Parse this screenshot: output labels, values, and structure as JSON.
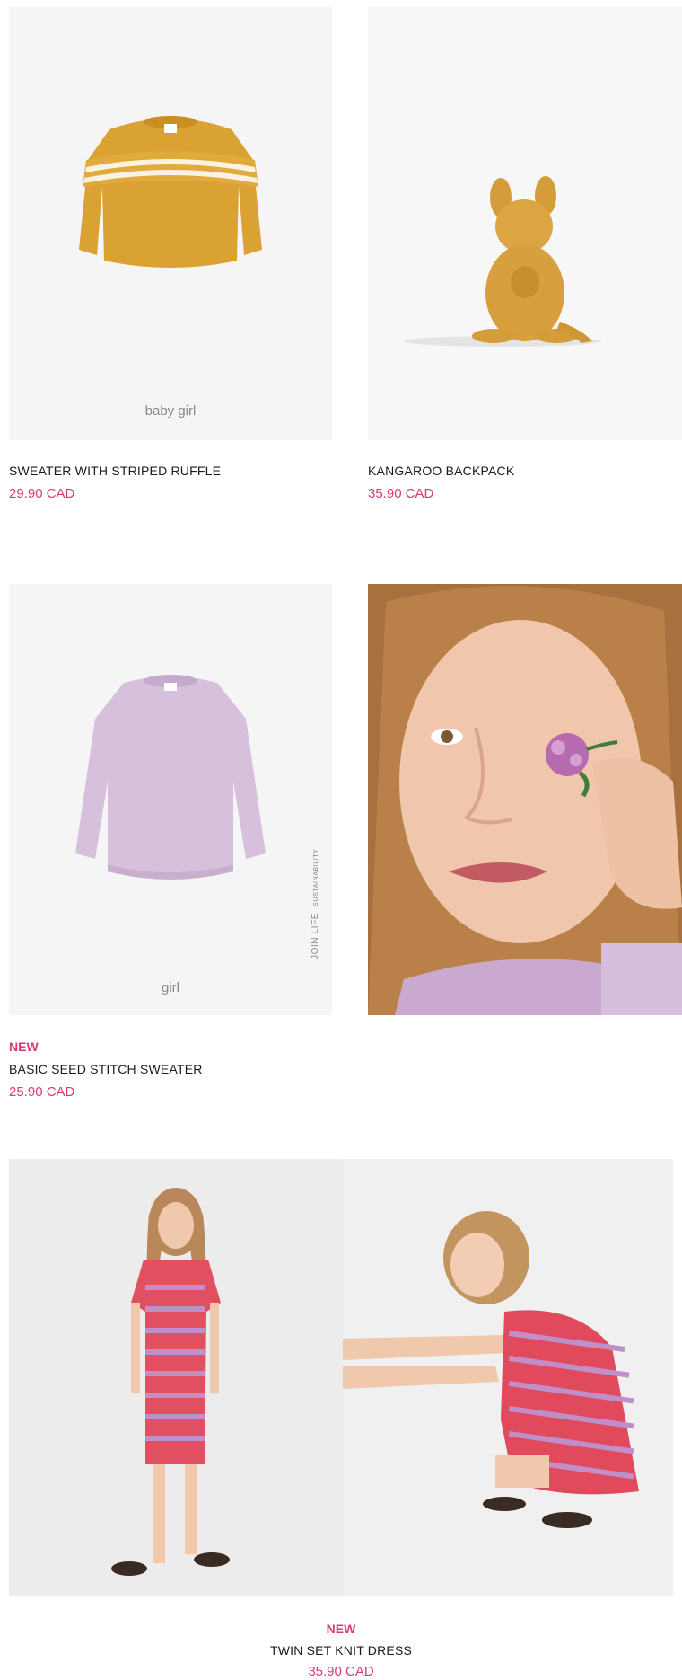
{
  "products": [
    {
      "name": "SWEATER WITH STRIPED RUFFLE",
      "price": "29.90 CAD",
      "caption": "baby girl"
    },
    {
      "name": "KANGAROO BACKPACK",
      "price": "35.90 CAD"
    },
    {
      "badge": "NEW",
      "name": "BASIC SEED STITCH SWEATER",
      "price": "25.90 CAD",
      "caption": "girl",
      "vertical_label": "JOIN LIFE",
      "vertical_sublabel": "SUSTAINABILITY"
    },
    {
      "badge": "NEW",
      "name": "TWIN SET KNIT DRESS",
      "price": "35.90 CAD"
    }
  ],
  "colors": {
    "accent": "#d63a79",
    "text": "#1a1a1a",
    "photo_bg": "#f4f4f4"
  }
}
